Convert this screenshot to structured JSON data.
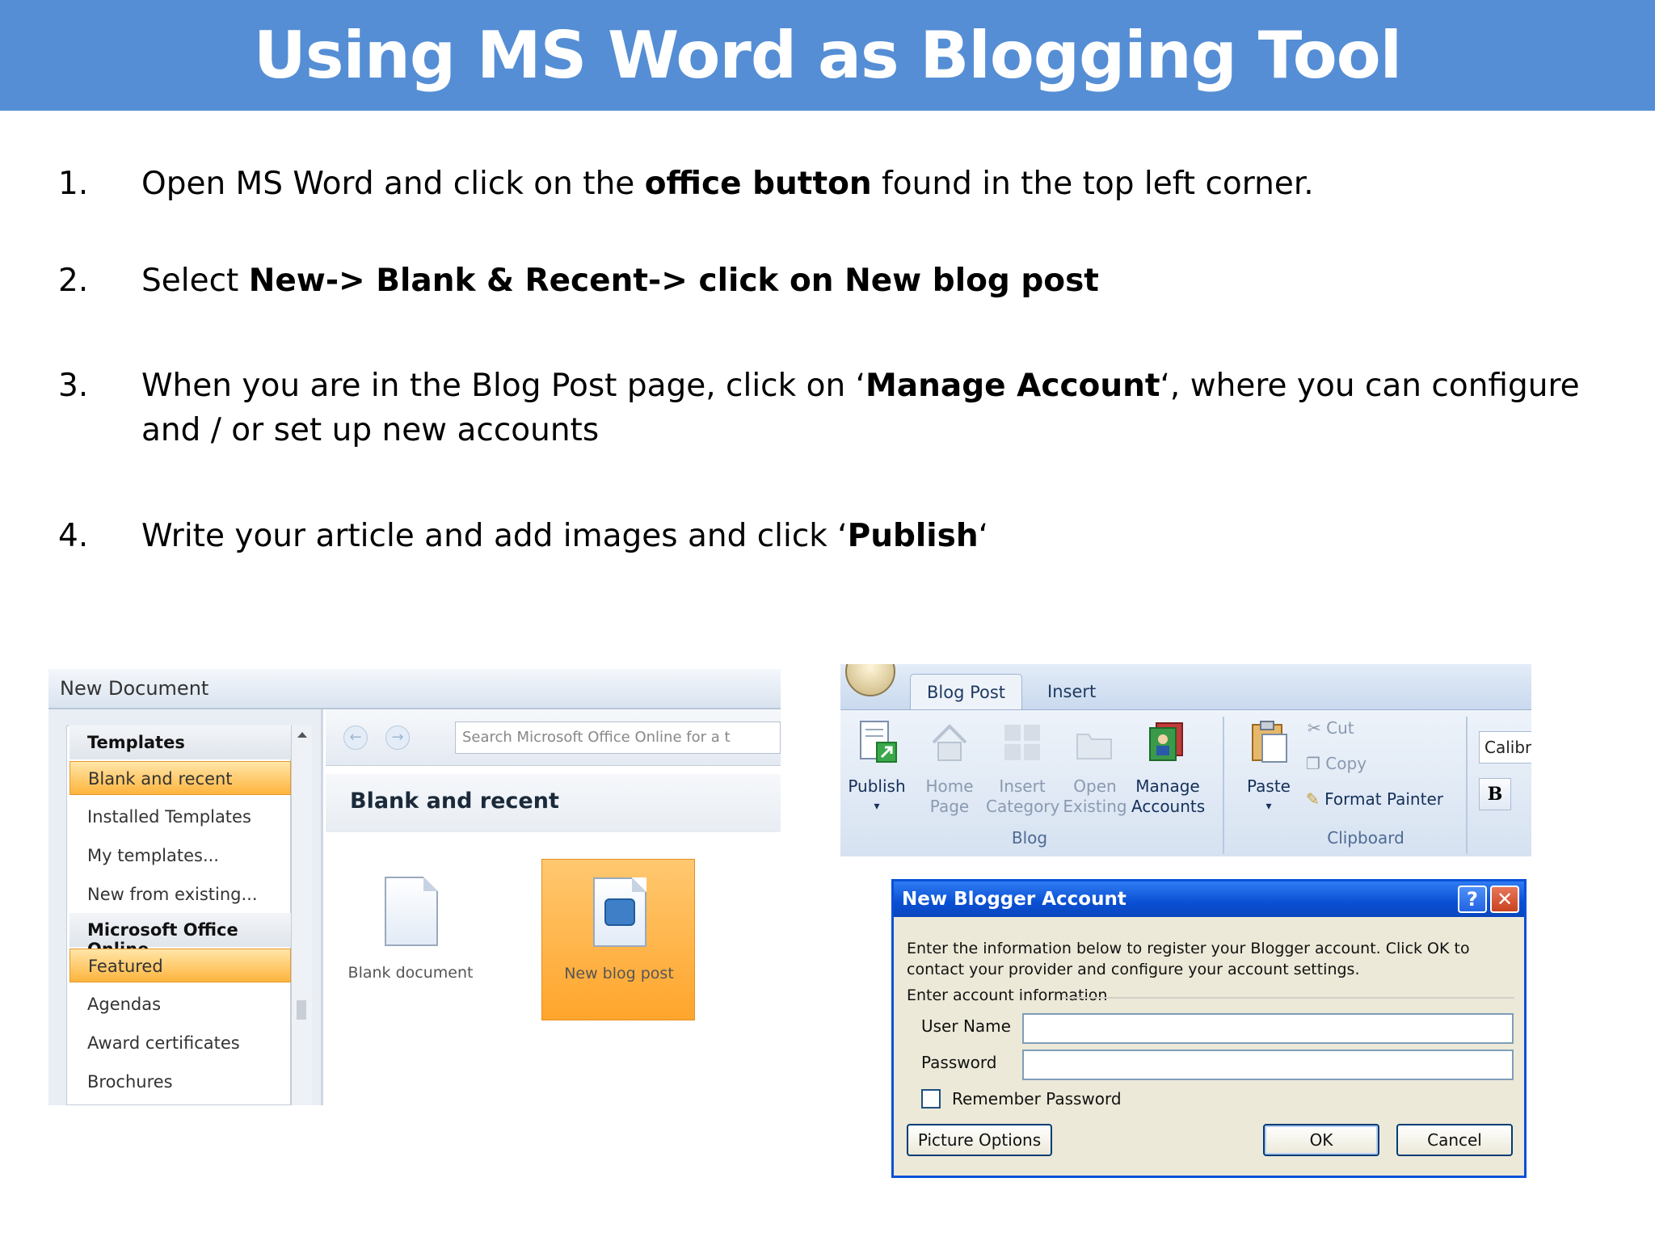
{
  "slide": {
    "title": "Using MS Word as Blogging Tool"
  },
  "steps": [
    {
      "num": "1.",
      "before": "Open MS Word and click on the ",
      "bold": "office button",
      "after": " found in the top left corner."
    },
    {
      "num": "2.",
      "before": "Select ",
      "bold": "New-> Blank & Recent-> click on New blog post",
      "after": ""
    },
    {
      "num": "3.",
      "before": "When you are in the Blog Post page, click on ‘",
      "bold": "Manage Account",
      "after": "‘, where you can configure and / or set up new accounts"
    },
    {
      "num": "4.",
      "before": "Write your article and add images and click ‘",
      "bold": "Publish",
      "after": "‘"
    }
  ],
  "new_document": {
    "window_title": "New Document",
    "sidebar": {
      "items": [
        {
          "label": "Templates",
          "type": "header"
        },
        {
          "label": "Blank and recent",
          "type": "selected"
        },
        {
          "label": "Installed Templates",
          "type": "item"
        },
        {
          "label": "My templates...",
          "type": "item"
        },
        {
          "label": "New from existing...",
          "type": "item"
        },
        {
          "label": "Microsoft Office Online",
          "type": "header"
        },
        {
          "label": "Featured",
          "type": "selected"
        },
        {
          "label": "Agendas",
          "type": "item"
        },
        {
          "label": "Award certificates",
          "type": "item"
        },
        {
          "label": "Brochures",
          "type": "item"
        }
      ]
    },
    "search_placeholder": "Search Microsoft Office Online for a t",
    "section_heading": "Blank and recent",
    "tiles": [
      {
        "label": "Blank document"
      },
      {
        "label": "New blog post"
      }
    ]
  },
  "ribbon": {
    "tabs": [
      "Blog Post",
      "Insert"
    ],
    "blog_group": {
      "label": "Blog",
      "buttons": [
        {
          "line1": "Publish",
          "line2": "▾",
          "enabled": true
        },
        {
          "line1": "Home",
          "line2": "Page",
          "enabled": false
        },
        {
          "line1": "Insert",
          "line2": "Category",
          "enabled": false
        },
        {
          "line1": "Open",
          "line2": "Existing",
          "enabled": false
        },
        {
          "line1": "Manage",
          "line2": "Accounts",
          "enabled": true
        }
      ]
    },
    "clipboard_group": {
      "label": "Clipboard",
      "paste": "Paste",
      "cut": "Cut",
      "copy": "Copy",
      "format_painter": "Format Painter"
    },
    "font_name": "Calibr",
    "bold_label": "B"
  },
  "dialog": {
    "title": "New Blogger Account",
    "help": "?",
    "close": "✕",
    "description": "Enter the information below to register your Blogger account. Click OK to contact your provider and configure your account settings.",
    "section": "Enter account information",
    "user_name_label": "User Name",
    "password_label": "Password",
    "remember_label": "Remember Password",
    "picture_options": "Picture Options",
    "ok": "OK",
    "cancel": "Cancel"
  }
}
